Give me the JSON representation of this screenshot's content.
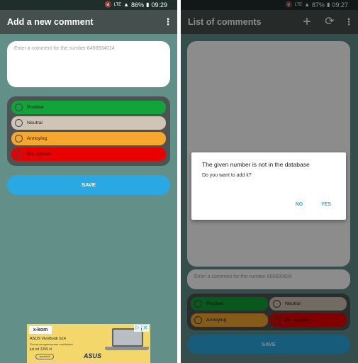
{
  "colors": {
    "background": "#638f89",
    "status_bar": "#1f2d2b",
    "app_bar": "#454f4d",
    "positive": "#12a33a",
    "neutral": "#d0c4b6",
    "annoying": "#f5a72f",
    "dangerous": "#ea0000",
    "save_button": "#2aa8e1",
    "dialog_action": "#2aa8e1"
  },
  "left_screen": {
    "status_bar": {
      "icons": [
        "mute-icon",
        "lte-icon",
        "signal-icon"
      ],
      "battery": "86%",
      "time": "09:29"
    },
    "app_bar": {
      "title": "Add a new comment",
      "menu_icon": "more-vert-icon"
    },
    "comment_input": {
      "placeholder": "Enter a comment for the number 6466934014"
    },
    "ratings": [
      {
        "label": "Positive",
        "color": "#12a33a"
      },
      {
        "label": "Neutral",
        "color": "#d0c4b6"
      },
      {
        "label": "Annoying",
        "color": "#f5a72f"
      },
      {
        "label": "Dangerous",
        "color": "#ea0000"
      }
    ],
    "save_label": "SAVE",
    "ad": {
      "brand": "x-kom",
      "product": "ASUS VivoBook S14",
      "tagline": "Poczuj nieograniczone możliwości",
      "price": "już od 2299 zł",
      "button": "sprawdź",
      "logo": "ASUS",
      "close_icon": "close-icon"
    }
  },
  "right_screen": {
    "status_bar": {
      "icons": [
        "mute-icon",
        "lte-icon",
        "signal-icon"
      ],
      "battery": "87%",
      "time": "09:27"
    },
    "app_bar": {
      "title": "List of comments",
      "icons": [
        "add-icon",
        "refresh-icon",
        "more-vert-icon"
      ]
    },
    "comment_input": {
      "placeholder": "Enter a comment for the number 600600600"
    },
    "ratings": [
      {
        "label": "Positive",
        "color": "#12a33a"
      },
      {
        "label": "Neutral",
        "color": "#d0c4b6"
      },
      {
        "label": "Annoying",
        "color": "#f5a72f"
      },
      {
        "label": "Dangerous",
        "color": "#ea0000"
      }
    ],
    "save_label": "SAVE",
    "dialog": {
      "title": "The given number is not in the database",
      "message": "Do you want to add it?",
      "no_label": "NO",
      "yes_label": "YES"
    }
  }
}
